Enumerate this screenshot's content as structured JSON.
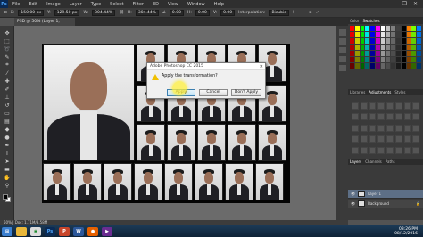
{
  "app": {
    "logo": "Ps",
    "menu": [
      "File",
      "Edit",
      "Image",
      "Layer",
      "Type",
      "Select",
      "Filter",
      "3D",
      "View",
      "Window",
      "Help"
    ],
    "window_controls": [
      "—",
      "❐",
      "✕"
    ]
  },
  "options_bar": {
    "x": "150.00 px",
    "y": "129.50 px",
    "w": "304.44%",
    "h": "304.44%",
    "angle": "0.00",
    "h_skew": "0.00",
    "v_skew": "0.00",
    "interpolation_label": "Interpolation:",
    "interpolation_value": "Bicubic"
  },
  "document_tab": "PSD @ 50% (Layer 1, RGB/8)",
  "dialog": {
    "title": "Adobe Photoshop CC 2015",
    "message": "Apply the transformation?",
    "buttons": {
      "apply": "Apply",
      "cancel": "Cancel",
      "dont_apply": "Don't Apply"
    },
    "close": "✕"
  },
  "panels": {
    "swatch_tabs": [
      "Color",
      "Swatches"
    ],
    "library_tabs": [
      "Libraries",
      "Adjustments",
      "Styles"
    ],
    "layer_tabs": [
      "Layers",
      "Channels",
      "Paths"
    ],
    "layers": [
      "Layer 1",
      "Background"
    ]
  },
  "status": "50% | Doc: 1.71M/3.58M",
  "taskbar": {
    "icons": [
      "start",
      "explorer",
      "chrome",
      "photoshop",
      "powerpoint",
      "word",
      "firefox",
      "media"
    ],
    "time": "03:26 PM",
    "date": "08/12/2016"
  },
  "colors": {
    "ui_dark": "#2f2f2f",
    "canvas_bg": "#6b6b6b",
    "highlight": "#f5e83a"
  }
}
